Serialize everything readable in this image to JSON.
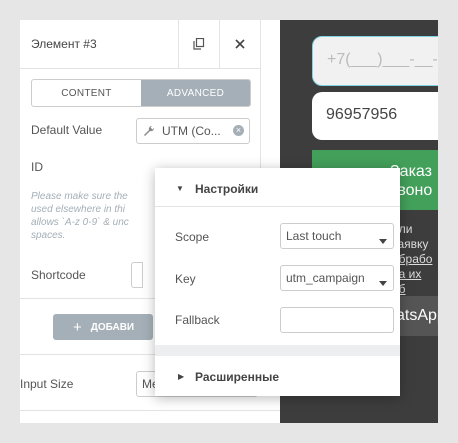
{
  "panel": {
    "title": "Элемент #3",
    "tabs": [
      {
        "label": "CONTENT",
        "active": false
      },
      {
        "label": "ADVANCED",
        "active": true
      }
    ],
    "default_value_label": "Default Value",
    "default_value_text": "UTM (Co...",
    "id_label": "ID",
    "help_text": "Please make sure the ... used elsewhere in thi... allows `A-z 0-9` & unc... spaces.",
    "help_lines": [
      "Please make sure the",
      "used elsewhere in thi",
      "allows `A-z 0-9` & unc",
      "spaces."
    ],
    "shortcode_label": "Shortcode",
    "add_button_label": "ДОБАВИ",
    "input_size_label": "Input Size",
    "input_size_value": "Medium"
  },
  "popup": {
    "settings_title": "Настройки",
    "scope_label": "Scope",
    "scope_value": "Last touch",
    "key_label": "Key",
    "key_value": "utm_campaign",
    "fallback_label": "Fallback",
    "fallback_value": "",
    "advanced_title": "Расширенные"
  },
  "preview": {
    "phone_placeholder": "+7(___)___-__-",
    "phone_value": "96957956",
    "order_lines": [
      "Заказ",
      "звоно"
    ],
    "link_lines": [
      "или заявку",
      "обрабо",
      "на их об"
    ],
    "whatsapp_label": "atsApp"
  },
  "colors": {
    "tab_active_bg": "#a4afb7",
    "preview_bg": "#3d3d3d",
    "green_button": "#43a05a",
    "focus_border": "#7fd3e3"
  }
}
